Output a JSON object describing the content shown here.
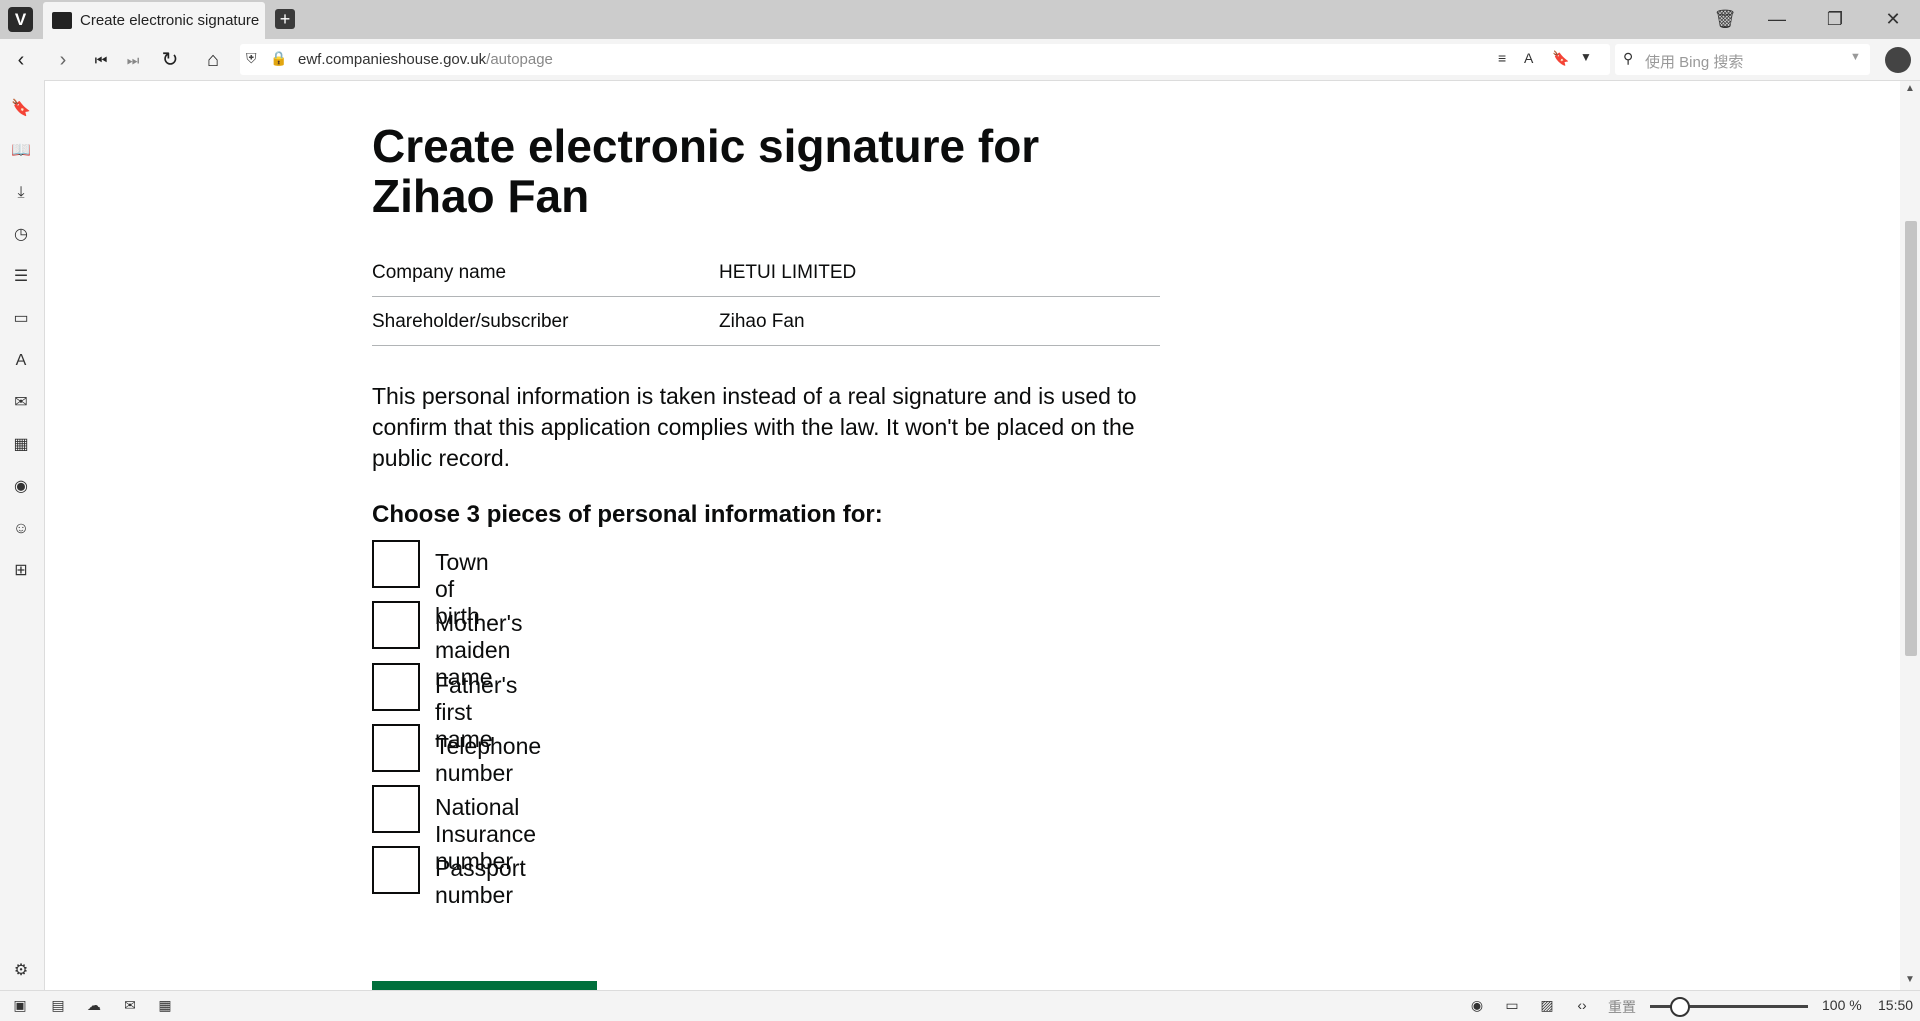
{
  "browser": {
    "tab_title": "Create electronic signature for Zihao Fan",
    "new_tab_symbol": "+",
    "url_host": "ewf.companieshouse.gov.uk",
    "url_path": "/autopage",
    "search_placeholder": "使用 Bing 搜索"
  },
  "page": {
    "title": "Create electronic signature for Zihao Fan",
    "summary": [
      {
        "key": "Company name",
        "value": "HETUI LIMITED"
      },
      {
        "key": "Shareholder/subscriber",
        "value": "Zihao Fan"
      }
    ],
    "intro": "This personal information is taken instead of a real signature and is used to confirm that this application complies with the law. It won't be placed on the public record.",
    "legend": "Choose 3 pieces of personal information for:",
    "options": [
      {
        "label": "Town of birth",
        "checked": false
      },
      {
        "label": "Mother's maiden name",
        "checked": false
      },
      {
        "label": "Father's first name",
        "checked": false
      },
      {
        "label": "Telephone number",
        "checked": false
      },
      {
        "label": "National Insurance number",
        "checked": false
      },
      {
        "label": "Passport number",
        "checked": false
      }
    ]
  },
  "statusbar": {
    "zoom_reset_label": "重置",
    "zoom_level": "100 %",
    "clock": "15:50"
  },
  "colors": {
    "continue_button": "#00703c",
    "chrome_bg": "#cccccc"
  }
}
